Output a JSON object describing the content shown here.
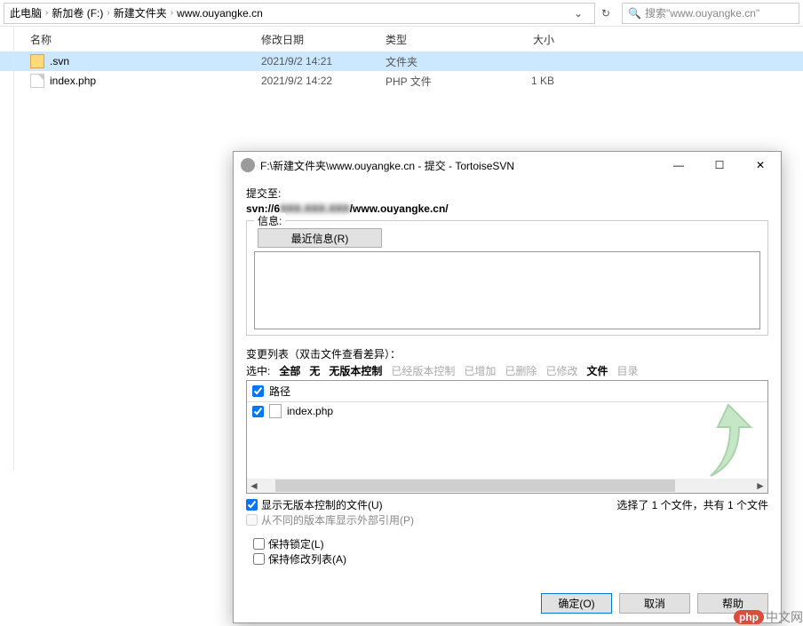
{
  "breadcrumbs": {
    "items": [
      "此电脑",
      "新加卷 (F:)",
      "新建文件夹",
      "www.ouyangke.cn"
    ]
  },
  "search": {
    "placeholder": "搜索\"www.ouyangke.cn\""
  },
  "columns": {
    "name": "名称",
    "date": "修改日期",
    "type": "类型",
    "size": "大小"
  },
  "files": [
    {
      "name": ".svn",
      "date": "2021/9/2 14:21",
      "type": "文件夹",
      "size": ""
    },
    {
      "name": "index.php",
      "date": "2021/9/2 14:22",
      "type": "PHP 文件",
      "size": "1 KB"
    }
  ],
  "dialog": {
    "title": "F:\\新建文件夹\\www.ouyangke.cn - 提交 - TortoiseSVN",
    "commit_to_label": "提交至:",
    "url_prefix": "svn://6",
    "url_hidden": "XXX.XXX.XXX",
    "url_suffix": "/www.ouyangke.cn/",
    "message_label": "信息:",
    "recent_messages": "最近信息(R)",
    "changes_label": "变更列表（双击文件查看差异）：",
    "filters": {
      "select_label": "选中:",
      "all": "全部",
      "none": "无",
      "unversioned": "无版本控制",
      "versioned": "已经版本控制",
      "added": "已增加",
      "deleted": "已删除",
      "modified": "已修改",
      "files": "文件",
      "dirs": "目录"
    },
    "changes_header": "路径",
    "changes_item": "index.php",
    "show_unversioned": "显示无版本控制的文件(U)",
    "show_externals": "从不同的版本库显示外部引用(P)",
    "selection_status": "选择了 1 个文件，共有 1 个文件",
    "keep_locks": "保持锁定(L)",
    "keep_changelists": "保持修改列表(A)",
    "ok": "确定(O)",
    "cancel": "取消",
    "help": "帮助"
  },
  "watermark": {
    "badge": "php",
    "text": "中文网"
  }
}
